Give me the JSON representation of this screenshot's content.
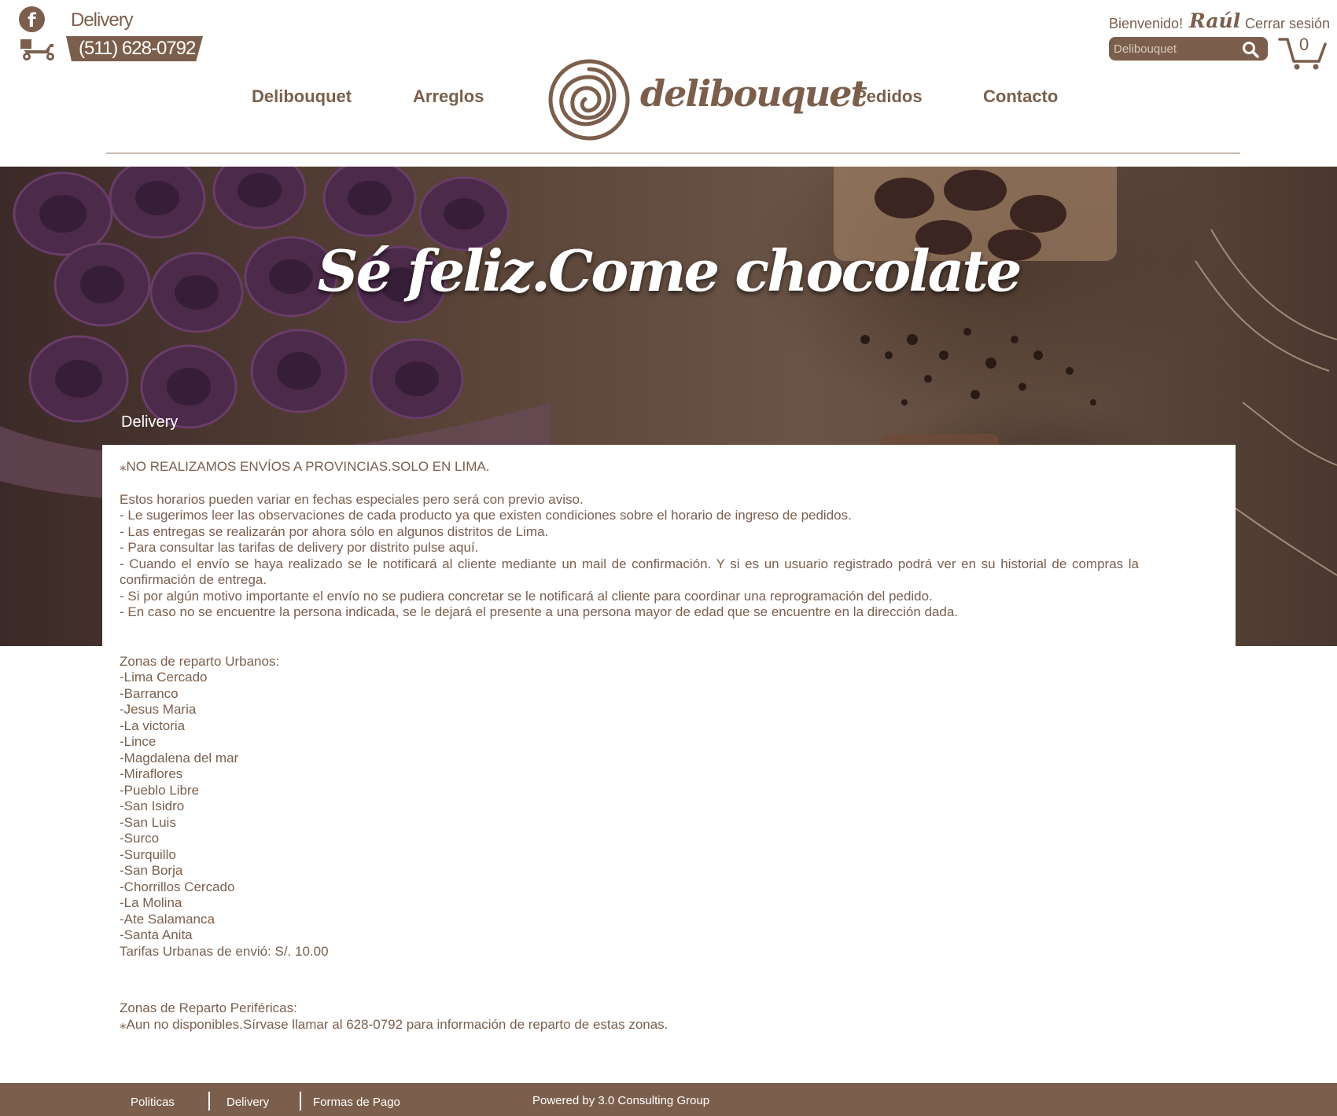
{
  "header": {
    "facebook_icon": "facebook-icon",
    "delivery_label": "Delivery",
    "phone": "(511) 628-0792",
    "welcome": "Bienvenido!",
    "user_name": "Raúl",
    "logout": "Cerrar sesión",
    "search_placeholder": "Delibouquet",
    "cart_count": "0",
    "logo_text": "delibouquet"
  },
  "nav": {
    "items": [
      {
        "label": "Delibouquet"
      },
      {
        "label": "Arreglos"
      },
      {
        "label": "Pedidos"
      },
      {
        "label": "Contacto"
      }
    ]
  },
  "hero": {
    "slogan": "Sé feliz.Come chocolate",
    "section_label": "Delivery"
  },
  "content": {
    "notice": "⁎NO REALIZAMOS ENVÍOS A PROVINCIAS.SOLO EN LIMA.",
    "rules": [
      "Estos horarios pueden variar en fechas especiales pero será con previo aviso.",
      "- Le sugerimos leer las observaciones de cada producto ya que existen condiciones sobre el horario de ingreso de pedidos.",
      "- Las entregas se realizarán por ahora sólo en algunos distritos de Lima.",
      "- Para consultar las tarifas de delivery por distrito pulse aquí.",
      "- Cuando el envío se haya realizado se le notificará al cliente mediante un mail de confirmación. Y si es un usuario registrado podrá ver en su historial de compras la confirmación de entrega.",
      "- Si por algún motivo importante el envío no se pudiera concretar se le notificará al cliente para coordinar una reprogramación del pedido.",
      "- En caso no se encuentre la persona indicada, se le dejará el presente a una persona mayor de edad que se encuentre en la dirección dada."
    ],
    "urban_title": "Zonas de reparto Urbanos:",
    "urban_zones": [
      "-Lima Cercado",
      "-Barranco",
      "-Jesus Maria",
      "-La victoria",
      "-Lince",
      "-Magdalena del mar",
      "-Miraflores",
      "-Pueblo Libre",
      "-San Isidro",
      "-San Luis",
      "-Surco",
      "-Surquillo",
      "-San Borja",
      "-Chorrillos Cercado",
      "-La Molina",
      "-Ate Salamanca",
      "-Santa Anita"
    ],
    "urban_rate": "Tarifas Urbanas de envió: S/. 10.00",
    "peripheral_title": "Zonas de Reparto Periféricas:",
    "peripheral_note": "⁎Aun no disponibles.Sírvase llamar al 628-0792 para información de reparto de estas zonas."
  },
  "footer": {
    "links": [
      {
        "label": "Politicas"
      },
      {
        "label": "Delivery"
      },
      {
        "label": "Formas de Pago"
      }
    ],
    "powered_by": "Powered by 3.0 Consulting Group"
  },
  "colors": {
    "brand": "#7b5f4c",
    "footer_bg": "#7b5f4c",
    "text": "#7b5f4c"
  }
}
